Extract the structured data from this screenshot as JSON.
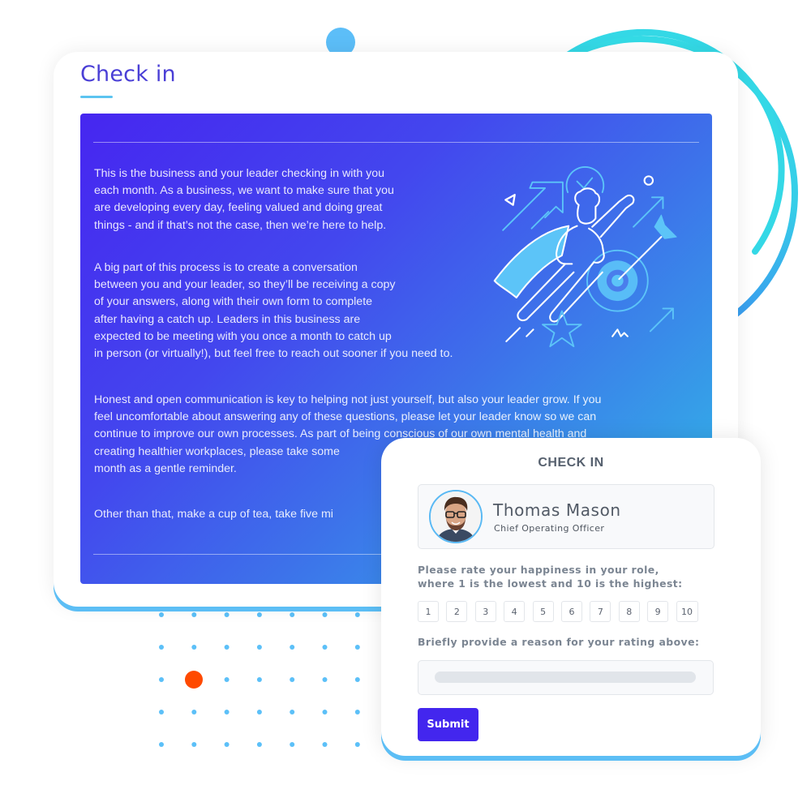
{
  "main": {
    "title": "Check in",
    "paragraphs": [
      {
        "lines": [
          "This is the business and your leader checking in with you",
          "each month. As a business, we want to make sure that you",
          "are developing every day, feeling valued and doing great",
          "things - and if that’s not the case, then we’re here to help."
        ]
      },
      {
        "lines": [
          "A big part of this process is to create a conversation",
          "between you and your leader, so they’ll be receiving a copy",
          "of your answers, along with their own form to complete",
          "after having a catch up. Leaders in this business are",
          "expected to be meeting with you once a month to catch up",
          "in person (or virtually!), but feel free to reach out sooner if you need to."
        ]
      },
      {
        "lines": [
          "Honest and open communication is key to helping not just yourself, but also your leader grow. If you",
          "feel uncomfortable about answering any of these questions, please let your leader know so we can",
          "continue to improve our own processes. As part of being conscious of our own mental health and",
          "creating healthier workplaces, please take some",
          "month as a gentle reminder."
        ]
      },
      {
        "lines": [
          "Other than that, make a cup of tea, take five mi"
        ]
      }
    ],
    "illustration": "superhero-target-illustration"
  },
  "checkin": {
    "title": "CHECK IN",
    "profile": {
      "name": "Thomas Mason",
      "role": "Chief Operating Officer",
      "avatar": "avatar-photo"
    },
    "question_rating": [
      "Please rate your happiness in your role,",
      "where 1 is the lowest and 10 is the highest:"
    ],
    "rating_options": [
      "1",
      "2",
      "3",
      "4",
      "5",
      "6",
      "7",
      "8",
      "9",
      "10"
    ],
    "question_reason": "Briefly provide a reason for your rating above:",
    "reason_value": "",
    "submit_label": "Submit"
  },
  "colors": {
    "brand": "#4326ee",
    "title": "#4a3fd6",
    "accent_light_blue": "#5cbef5",
    "accent_orange": "#ff4a00",
    "ring_cyan": "#34d8e6",
    "panel_gradient_start": "#4626f0",
    "panel_gradient_end": "#2fb6ea"
  }
}
